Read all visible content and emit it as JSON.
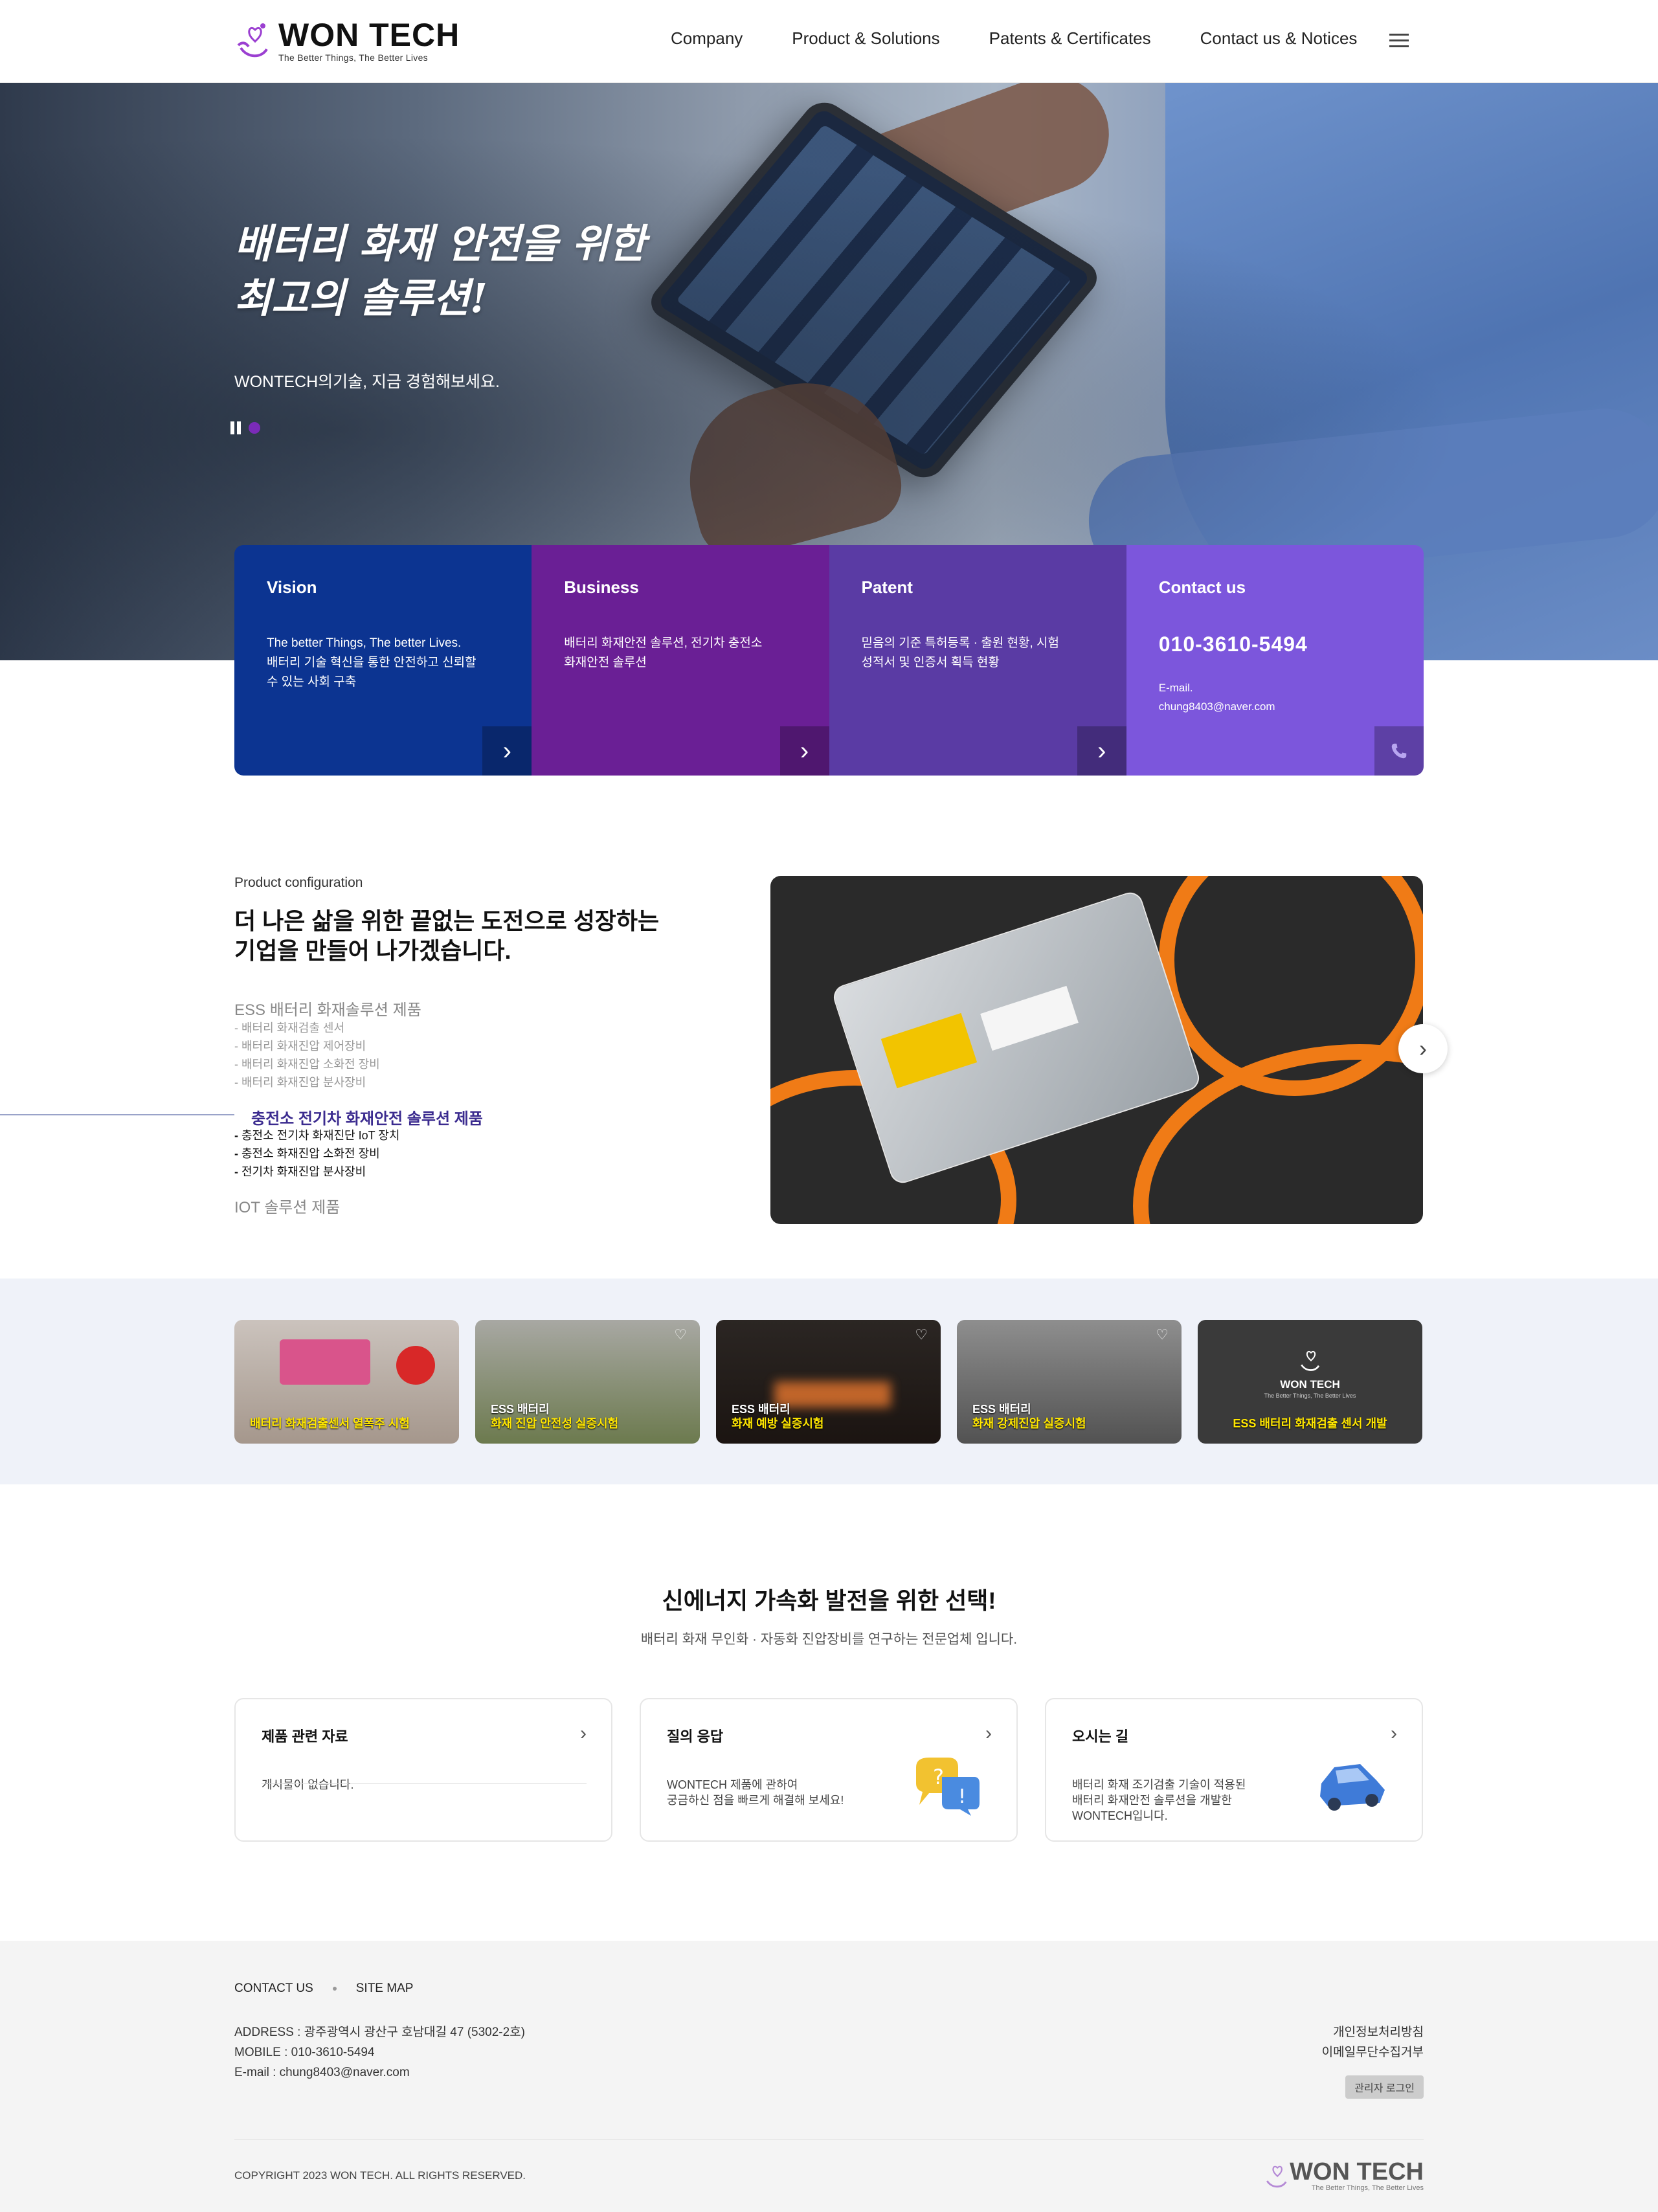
{
  "header": {
    "logo_title": "WON TECH",
    "logo_tagline": "The Better Things, The Better Lives",
    "nav": [
      "Company",
      "Product & Solutions",
      "Patents & Certificates",
      "Contact us & Notices"
    ]
  },
  "hero": {
    "title": "배터리 화재 안전을 위한\n최고의 솔루션!",
    "subtitle": "WONTECH의기술, 지금 경험해보세요."
  },
  "cards": [
    {
      "title": "Vision",
      "text": "The better Things, The better Lives.\n배터리 기술 혁신을 통한 안전하고 신뢰할\n수 있는 사회 구축"
    },
    {
      "title": "Business",
      "text": "배터리 화재안전 솔루션, 전기차 충전소\n화재안전 솔루션"
    },
    {
      "title": "Patent",
      "text": "믿음의 기준 특허등록 · 출원 현황, 시험\n성적서 및 인증서 획득 현황"
    },
    {
      "title": "Contact us",
      "phone": "010-3610-5494",
      "mail": "E-mail.\nchung8403@naver.com"
    }
  ],
  "product": {
    "label": "Product configuration",
    "title": "더 나은 삶을 위한 끝없는 도전으로 성장하는\n기업을 만들어 나가겠습니다.",
    "group1": "ESS 배터리 화재솔루션 제품",
    "group1_items": [
      "배터리 화재검출 센서",
      "배터리 화재진압 제어장비",
      "배터리 화재진압 소화전 장비",
      "배터리 화재진압 분사장비"
    ],
    "group2": "충전소 전기차 화재안전 솔루션 제품",
    "group2_items": [
      "충전소 전기차 화재진단 IoT 장치",
      "충전소 화재진압 소화전 장비",
      "전기차 화재진압 분사장비"
    ],
    "group3": "IOT 솔루션 제품"
  },
  "thumbs": [
    {
      "line1": "",
      "line2": "배터리 화재검출센서 열폭주 시험"
    },
    {
      "line1": "ESS 배터리",
      "line2": "화재 진압 안전성 실증시험"
    },
    {
      "line1": "ESS 배터리",
      "line2": "화재 예방 실증시험"
    },
    {
      "line1": "ESS 배터리",
      "line2": "화재 강제진압 실증시험"
    },
    {
      "line1": "",
      "line2": "ESS 배터리 화재검출 센서 개발",
      "logo": "WON TECH",
      "logo_sub": "The Better Things, The Better Lives"
    }
  ],
  "new_energy": {
    "title": "신에너지 가속화 발전을 위한 선택!",
    "subtitle": "배터리 화재 무인화 · 자동화 진압장비를 연구하는 전문업체 입니다.",
    "boxes": [
      {
        "title": "제품 관련 자료",
        "text": "게시물이 없습니다."
      },
      {
        "title": "질의 응답",
        "text": "WONTECH 제품에 관하여\n궁금하신 점을 빠르게 해결해 보세요!"
      },
      {
        "title": "오시는 길",
        "text": "배터리 화재 조기검출 기술이 적용된\n배터리 화재안전 솔루션을 개발한\nWONTECH입니다."
      }
    ]
  },
  "footer": {
    "links": [
      "CONTACT US",
      "SITE MAP"
    ],
    "info": "ADDRESS : 광주광역시 광산구 호남대길 47 (5302-2호)\nMOBILE : 010-3610-5494\nE-mail : chung8403@naver.com",
    "privacy": "개인정보처리방침",
    "email_policy": "이메일무단수집거부",
    "admin": "관리자 로그인",
    "copyright": "COPYRIGHT 2023 WON TECH. ALL RIGHTS RESERVED.",
    "logo_title": "WON TECH",
    "logo_tagline": "The Better Things, The Better Lives"
  },
  "colors": {
    "vision": "#0c3491",
    "business": "#6a1f95",
    "patent": "#5a3ba4",
    "contact": "#7c56dc",
    "accent": "#7a2bb8"
  }
}
